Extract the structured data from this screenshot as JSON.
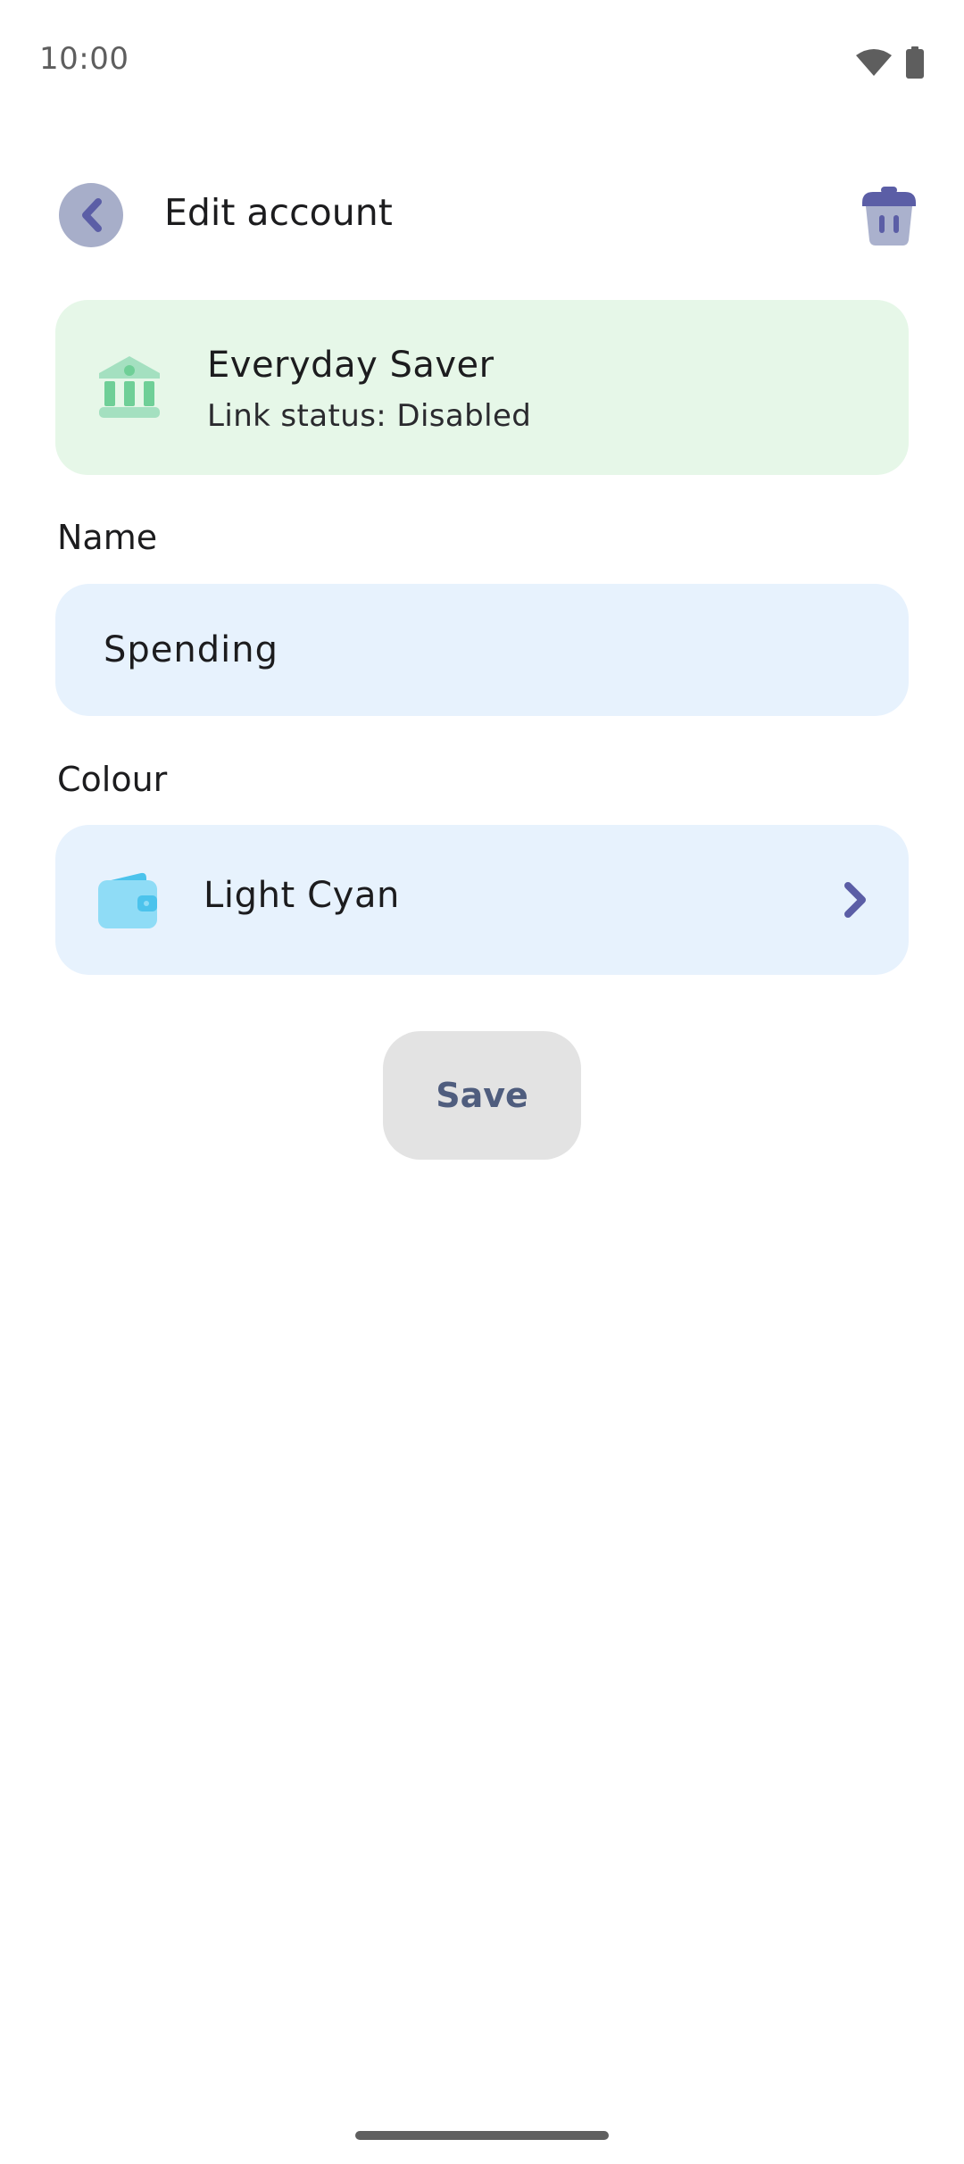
{
  "status_bar": {
    "time": "10:00",
    "wifi_icon": "wifi-icon",
    "battery_icon": "battery-icon"
  },
  "header": {
    "back_icon": "chevron-left-icon",
    "title": "Edit account",
    "delete_icon": "trash-icon"
  },
  "account_card": {
    "icon": "bank-icon",
    "name": "Everyday Saver",
    "link_status": "Link status: Disabled",
    "background_color": "#e6f7e8"
  },
  "name_field": {
    "label": "Name",
    "value": "Spending"
  },
  "colour_field": {
    "label": "Colour",
    "icon": "wallet-icon",
    "value": "Light Cyan",
    "color": "#8fdcf6",
    "chevron_icon": "chevron-right-icon"
  },
  "save_button": {
    "label": "Save"
  },
  "colors": {
    "accent": "#5b5ea6",
    "field_background": "#e7f2fd",
    "button_background": "#e3e3e3",
    "button_text": "#4f5d7e"
  }
}
